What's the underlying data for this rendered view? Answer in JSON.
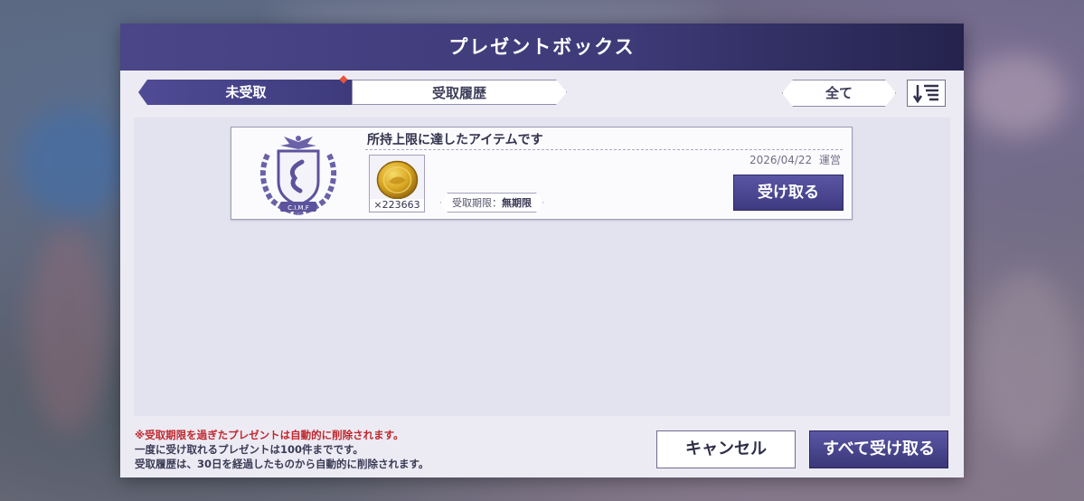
{
  "dialog": {
    "title": "プレゼントボックス"
  },
  "tabs": [
    {
      "label": "未受取",
      "active": true,
      "has_notification": true
    },
    {
      "label": "受取履歴",
      "active": false
    }
  ],
  "filter": {
    "label": "全て"
  },
  "sort": {
    "icon": "sort-descending-icon"
  },
  "presents": [
    {
      "title": "所持上限に達したアイテムです",
      "date": "2026/04/22",
      "sender": "運営",
      "item_icon": "gold-coin-icon",
      "emblem_icon": "crest-emblem-icon",
      "item_count": "×223663",
      "expiry_label": "受取期限：",
      "expiry_value": "無期限",
      "receive_label": "受け取る"
    }
  ],
  "notes": [
    "※受取期限を過ぎたプレゼントは自動的に削除されます。",
    "一度に受け取れるプレゼントは100件までです。",
    "受取履歴は、30日を経過したものから自動的に削除されます。"
  ],
  "footer": {
    "cancel_label": "キャンセル",
    "receive_all_label": "すべて受け取る"
  },
  "colors": {
    "accent": "#3e3a80",
    "header": "#4a4688",
    "note_red": "#c1272d"
  }
}
